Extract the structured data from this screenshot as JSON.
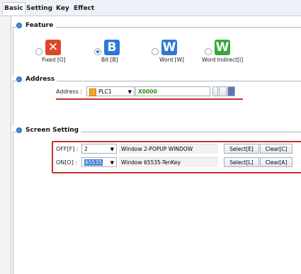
{
  "tabs": [
    "Basic",
    "Setting",
    "Key",
    "Effect"
  ],
  "feature": {
    "title": "Feature",
    "options": [
      {
        "icon_letter": "✕",
        "label": "Fixed [O]",
        "color": "#e0452b",
        "selected": false
      },
      {
        "icon_letter": "B",
        "label": "Bit [B]",
        "color": "#2f78d3",
        "selected": true
      },
      {
        "icon_letter": "W",
        "label": "Word [W]",
        "color": "#2f78d3",
        "selected": false
      },
      {
        "icon_letter": "W",
        "label": "Word Indirect[I]",
        "color": "#3aa63c",
        "selected": false
      }
    ]
  },
  "address": {
    "title": "Address",
    "label": "Address :",
    "plc": "PLC1",
    "value": "X0000"
  },
  "screen": {
    "title": "Screen Setting",
    "rows": [
      {
        "label": "OFF[F] :",
        "num": "2",
        "window": "Window 2-POPUP WINDOW",
        "select": "Select[E]",
        "clear": "Clear[C]"
      },
      {
        "label": "ON[O] :",
        "num": "65535",
        "window": "Window 65535-TenKey",
        "select": "Select[L]",
        "clear": "Clear[A]"
      }
    ]
  }
}
